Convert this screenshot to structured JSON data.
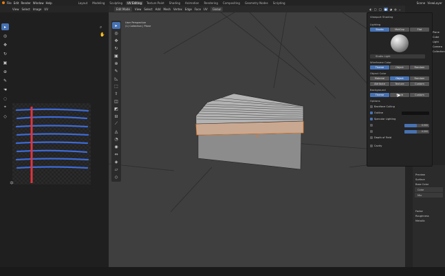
{
  "menubar": {
    "menus": [
      "File",
      "Edit",
      "Render",
      "Window",
      "Help"
    ],
    "workspaces": [
      "Layout",
      "Modeling",
      "Sculpting",
      "UV Editing",
      "Texture Paint",
      "Shading",
      "Animation",
      "Rendering",
      "Compositing",
      "Geometry Nodes",
      "Scripting"
    ],
    "active_workspace": "UV Editing",
    "scene_label": "Scene",
    "layer_label": "ViewLayer"
  },
  "left_editor": {
    "header": [
      "View",
      "Select",
      "Image",
      "UV"
    ]
  },
  "viewport": {
    "mode": "Edit Mode",
    "header_items": [
      "View",
      "Select",
      "Add",
      "Mesh",
      "Vertex",
      "Edge",
      "Face",
      "UV"
    ],
    "transform_orientation": "Global",
    "info_line1": "User Perspective",
    "info_line2": "(1) Collection | Plane"
  },
  "shading_popover": {
    "title": "Viewport Shading",
    "lighting_label": "Lighting",
    "lighting_options": [
      "Studio",
      "MatCap",
      "Flat"
    ],
    "lighting_active": "Studio",
    "matcap_name": "Studio Light",
    "wireframe_color_label": "Wireframe Color",
    "wireframe_options": [
      "Theme",
      "Object",
      "Random"
    ],
    "wireframe_active": "Theme",
    "object_color_label": "Object Color",
    "object_color_options": [
      "Material",
      "Object",
      "Random",
      "Attribute",
      "Texture",
      "Custom"
    ],
    "object_color_active": "Object",
    "background_label": "Background",
    "background_options": [
      "Theme",
      "World",
      "Custom"
    ],
    "background_active": "Theme",
    "options_label": "Options",
    "backface_culling": "Backface Culling",
    "outline": "Outline",
    "specular": "Specular Lighting",
    "shadow_value": "0.500",
    "cavity_value": "0.500",
    "depth_of_field": "Depth of Field",
    "cavity": "Cavity"
  },
  "properties": {
    "items": [
      "Preview",
      "Surface",
      "Base Color",
      "Color",
      "Mix",
      "Factor",
      "Roughness",
      "Metallic"
    ]
  },
  "outliner": {
    "items": [
      "Plane",
      "Cube",
      "Light",
      "Camera",
      "Collection"
    ]
  },
  "colors": {
    "accent": "#4772b3",
    "uv_line_blue": "#3d6bd8",
    "uv_line_red": "#e0343c",
    "selected_face": "#c9a892"
  }
}
